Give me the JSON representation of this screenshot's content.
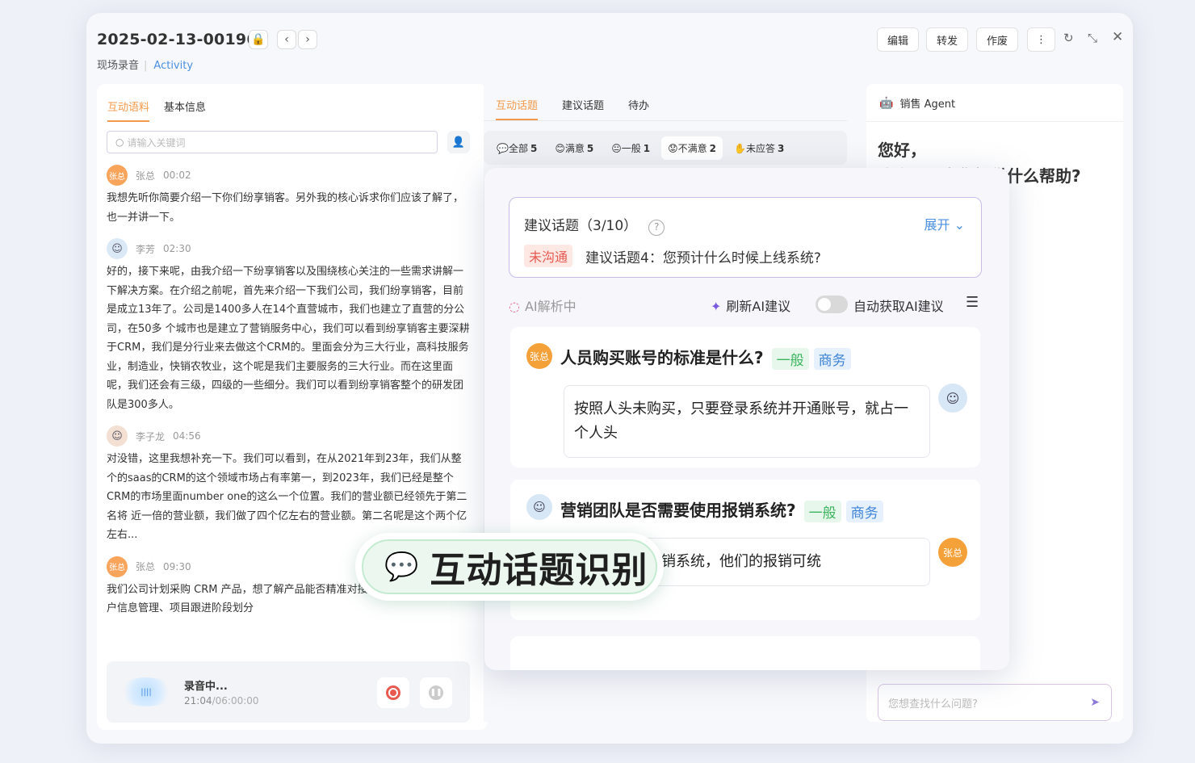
{
  "header": {
    "title": "2025-02-13-001960",
    "subtitle": "现场录音",
    "subtitle_link": "Activity",
    "buttons": {
      "edit": "编辑",
      "forward": "转发",
      "void": "作废"
    }
  },
  "left_panel": {
    "tabs": [
      "互动语料",
      "基本信息"
    ],
    "search_placeholder": "请输入关键词",
    "messages": [
      {
        "avatar_text": "张总",
        "speaker": "张总",
        "time": "00:02",
        "text": "我想先听你简要介绍一下你们纷享销客。另外我的核心诉求你们应该了解了，也一并讲一下。"
      },
      {
        "avatar_text": "",
        "speaker": "李芳",
        "time": "02:30",
        "text": "好的，接下来呢，由我介绍一下纷享销客以及围绕核心关注的一些需求讲解一下解决方案。在介绍之前呢，首先来介绍一下我们公司，我们纷享销客，目前是成立13年了。公司是1400多人在14个直营城市，我们也建立了直营的分公司，在50多 个城市也是建立了营销服务中心，我们可以看到纷享销客主要深耕于CRM，我们是分行业来去做这个CRM的。里面会分为三大行业，高科技服务业，制造业，快销农牧业，这个呢是我们主要服务的三大行业。而在这里面呢，我们还会有三级，四级的一些细分。我们可以看到纷享销客整个的研发团队是300多人。"
      },
      {
        "avatar_text": "",
        "speaker": "李子龙",
        "time": "04:56",
        "text": "对没错，这里我想补充一下。我们可以看到，在从2021年到23年，我们从整个的saas的CRM的这个领域市场占有率第一，到2023年，我们已经是整个CRM的市场里面number one的这么一个位置。我们的营业额已经领先于第二名将 近一倍的营业额，我们做了四个亿左右的营业额。第二名呢是这个两个亿左右..."
      },
      {
        "avatar_text": "张总",
        "speaker": "张总",
        "time": "09:30",
        "text": "我们公司计划采购 CRM 产品，想了解产品能否精准对接指向业务流程，如客户信息管理、项目跟进阶段划分"
      }
    ],
    "recording": {
      "label": "录音中...",
      "elapsed": "21:04",
      "total": "/06:00:00"
    }
  },
  "middle_panel": {
    "tabs": [
      "互动话题",
      "建议话题",
      "待办"
    ],
    "filters": [
      {
        "label": "全部",
        "count": "5"
      },
      {
        "label": "满意",
        "count": "5"
      },
      {
        "label": "一般",
        "count": "1"
      },
      {
        "label": "不满意",
        "count": "2"
      },
      {
        "label": "未应答",
        "count": "3"
      }
    ]
  },
  "suggestion": {
    "title": "建议话题（3/10）",
    "expand": "展开",
    "badge": "未沟通",
    "question": "建议话题4：您预计什么时候上线系统?",
    "ai_status": "AI解析中",
    "refresh": "刷新AI建议",
    "auto": "自动获取AI建议"
  },
  "topics": [
    {
      "avatar_text": "张总",
      "question": "人员购买账号的标准是什么?",
      "tag1": "一般",
      "tag2": "商务",
      "answer": "按照人头未购买，只要登录系统并开通账号，就占一个人头"
    },
    {
      "avatar_text": "",
      "question": "营销团队是否需要使用报销系统?",
      "tag1": "一般",
      "tag2": "商务",
      "answer": "不需要使用报销系统，他们的报销可统",
      "responder_text": "张总"
    }
  ],
  "agent": {
    "title": "销售 Agent",
    "greet1": "您好，",
    "greet2": "我会可以为您提供什么帮助?",
    "ask_placeholder": "您想查找什么问题?"
  },
  "overlay": {
    "label": "互动话题识别"
  }
}
